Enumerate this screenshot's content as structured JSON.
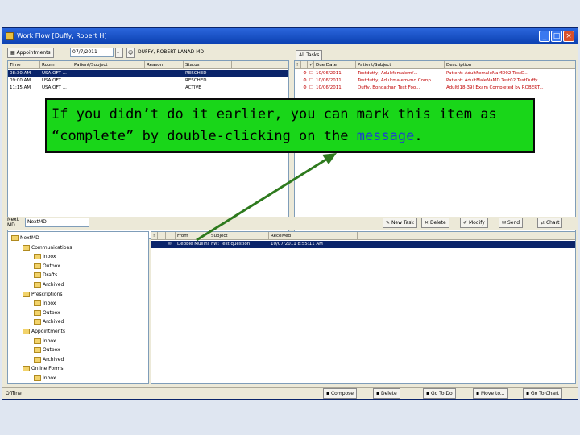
{
  "window": {
    "title": "Work Flow [Duffy, Robert H]"
  },
  "appointments": {
    "tab_label": "Appointments",
    "date": "07/7/2011",
    "provider": "DUFFY, ROBERT LANAD MD",
    "columns": [
      "Time",
      "Room",
      "Patient/Subject",
      "Reason",
      "Status"
    ],
    "rows": [
      [
        "08:30 AM",
        "USA OFT ...",
        "",
        "",
        "RESCHED"
      ],
      [
        "09:00 AM",
        "USA OFT ...",
        "",
        "",
        "RESCHED"
      ],
      [
        "11:15 AM",
        "USA OFT ...",
        "",
        "",
        "ACTIVE"
      ]
    ]
  },
  "tasks": {
    "tab_label": "All Tasks",
    "columns": [
      "!",
      "",
      "✓",
      "Due Date",
      "Patient/Subject",
      "Description"
    ],
    "rows": [
      {
        "due": "10/06/2011",
        "patient": "Testdutty, Adultfemalem/...",
        "desc": "Patient: AdultFemaleNaMD02 TestD...",
        "red": true
      },
      {
        "due": "10/06/2011",
        "patient": "Testdutty, Adultmalem-md Comp...",
        "desc": "Patient: AdultMaleNaMD Test02 TestDuffy ...",
        "red": true
      },
      {
        "due": "10/06/2011",
        "patient": "Duffy, Bondathan Test Foo...",
        "desc": "Adult(18-39) Exam Completed by ROBERT...",
        "red": true
      }
    ]
  },
  "messages": {
    "mailbox": "NextMD",
    "toolbar": [
      "New Task",
      "Delete",
      "Modify",
      "Send",
      "Chart"
    ],
    "columns": [
      "!",
      "",
      "",
      "From",
      "Subject",
      "Received"
    ],
    "rows": [
      {
        "from": "Debbie Mullins",
        "subject": "FW: Test question",
        "received": "10/07/2011 8:55:11 AM"
      }
    ],
    "bottom_toolbar": [
      "Compose",
      "Delete",
      "Go To Do",
      "Move to...",
      "Go To Chart"
    ]
  },
  "tree": [
    {
      "label": "NextMD",
      "level": 0,
      "icon": "nextmd-icon"
    },
    {
      "label": "Communications",
      "level": 1,
      "icon": "folder-icon"
    },
    {
      "label": "Inbox",
      "level": 2,
      "icon": "folder-icon"
    },
    {
      "label": "Outbox",
      "level": 2,
      "icon": "folder-icon"
    },
    {
      "label": "Drafts",
      "level": 2,
      "icon": "folder-icon"
    },
    {
      "label": "Archived",
      "level": 2,
      "icon": "folder-icon"
    },
    {
      "label": "Prescriptions",
      "level": 1,
      "icon": "rx-icon"
    },
    {
      "label": "Inbox",
      "level": 2,
      "icon": "folder-icon"
    },
    {
      "label": "Outbox",
      "level": 2,
      "icon": "folder-icon"
    },
    {
      "label": "Archived",
      "level": 2,
      "icon": "folder-icon"
    },
    {
      "label": "Appointments",
      "level": 1,
      "icon": "calendar-icon"
    },
    {
      "label": "Inbox",
      "level": 2,
      "icon": "folder-icon"
    },
    {
      "label": "Outbox",
      "level": 2,
      "icon": "folder-icon"
    },
    {
      "label": "Archived",
      "level": 2,
      "icon": "folder-icon"
    },
    {
      "label": "Online Forms",
      "level": 1,
      "icon": "form-icon"
    },
    {
      "label": "Inbox",
      "level": 2,
      "icon": "folder-icon"
    }
  ],
  "status": {
    "text": "Offline"
  },
  "callout": {
    "text_before": "If you didn’t do it earlier, you can mark this item as “complete” by double-clicking on the ",
    "highlight": "message",
    "text_after": "."
  },
  "colors": {
    "callout_bg": "#19d619",
    "arrow": "#2e7a1e",
    "highlight": "#1f3ecf",
    "titlebar": "#0b3fb0",
    "overdue": "#c00000"
  }
}
